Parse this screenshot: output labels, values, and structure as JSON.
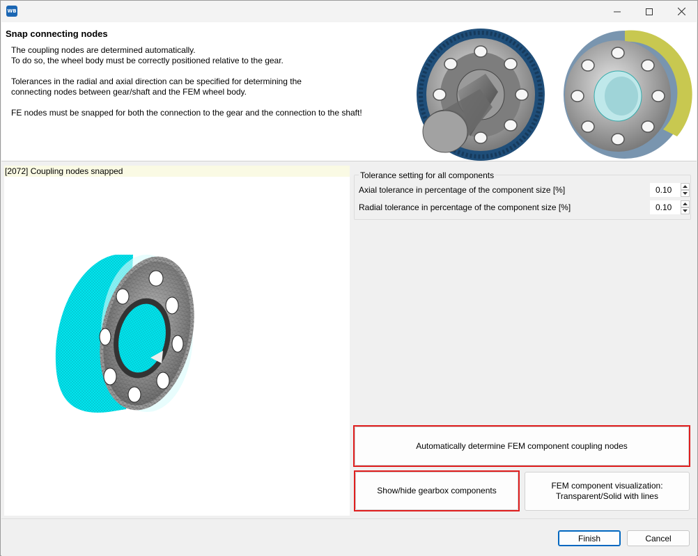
{
  "titlebar": {
    "app_icon_text": "WB",
    "icons": {
      "minimize": "minimize-icon",
      "maximize": "maximize-icon",
      "close": "close-icon"
    }
  },
  "header": {
    "title": "Snap connecting nodes",
    "lines": [
      "The coupling nodes are determined automatically.",
      "To do so, the wheel body must be correctly positioned relative to the gear.",
      "Tolerances in the radial and axial direction can be specified for determining the",
      "connecting nodes between gear/shaft and the FEM wheel body.",
      "FE nodes must be snapped for both the connection to the gear and the connection to the shaft!"
    ]
  },
  "viewer": {
    "status": "[2072] Coupling nodes snapped"
  },
  "tolerance": {
    "group_title": "Tolerance setting for all components",
    "axial_label": "Axial tolerance in percentage of the component size [%]",
    "axial_value": "0.10",
    "radial_label": "Radial tolerance in percentage of the component size [%]",
    "radial_value": "0.10"
  },
  "actions": {
    "auto_determine": "Automatically determine FEM component coupling nodes",
    "show_hide": "Show/hide gearbox components",
    "visualization_line1": "FEM component visualization:",
    "visualization_line2": "Transparent/Solid with lines"
  },
  "footer": {
    "finish": "Finish",
    "cancel": "Cancel"
  },
  "colors": {
    "accent": "#0067c0",
    "highlight": "#e01e1e",
    "status_bg": "#fafae4",
    "mesh_cyan": "#00e5ee",
    "gear_blue": "#1f4e79",
    "gear_yellow": "#c8c850"
  }
}
